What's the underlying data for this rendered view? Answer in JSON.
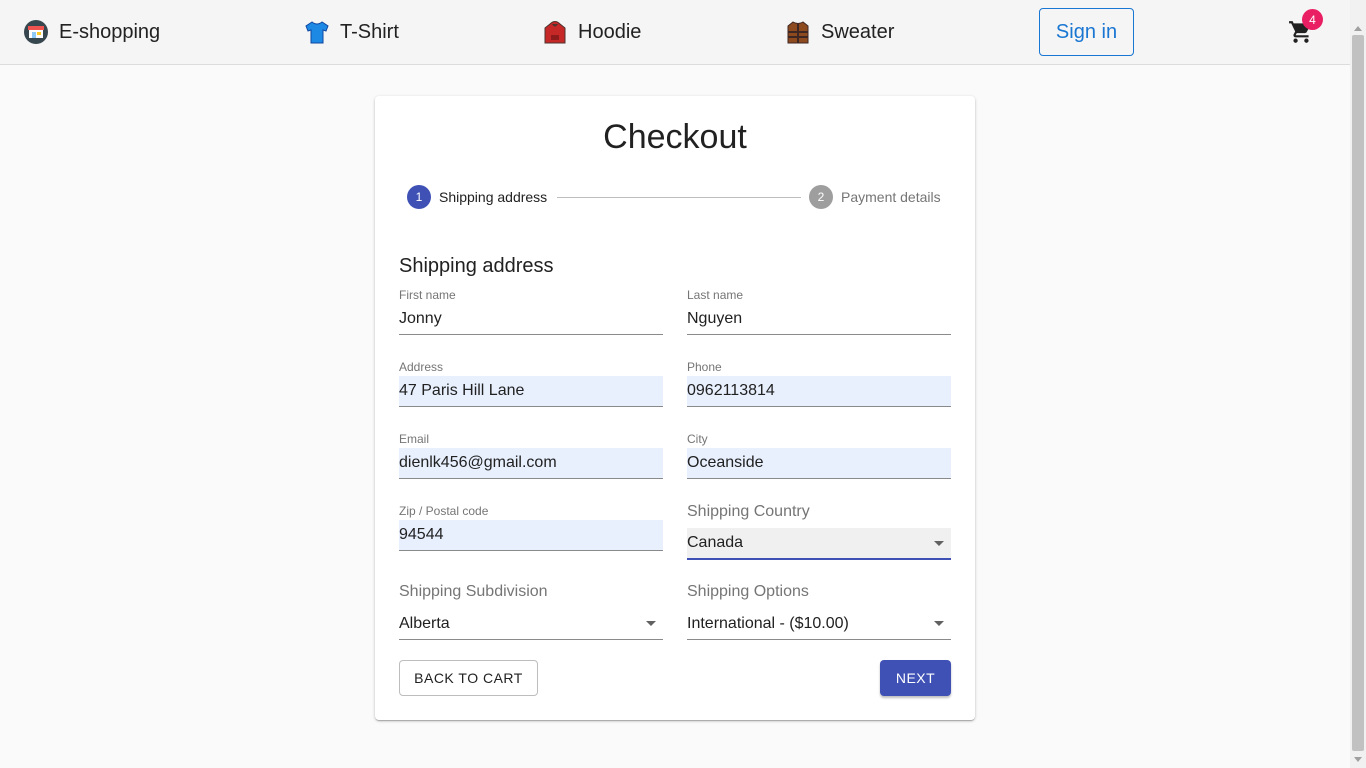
{
  "nav": {
    "brand": "E-shopping",
    "items": [
      {
        "label": "T-Shirt",
        "icon": "tshirt-icon"
      },
      {
        "label": "Hoodie",
        "icon": "hoodie-icon"
      },
      {
        "label": "Sweater",
        "icon": "sweater-icon"
      }
    ],
    "signin_label": "Sign in",
    "cart_count": "4"
  },
  "checkout": {
    "title": "Checkout",
    "steps": [
      {
        "number": "1",
        "label": "Shipping address",
        "active": true
      },
      {
        "number": "2",
        "label": "Payment details",
        "active": false
      }
    ],
    "section_title": "Shipping address",
    "fields": {
      "first_name": {
        "label": "First name",
        "value": "Jonny"
      },
      "last_name": {
        "label": "Last name",
        "value": "Nguyen"
      },
      "address": {
        "label": "Address",
        "value": "47 Paris Hill Lane"
      },
      "phone": {
        "label": "Phone",
        "value": "0962113814"
      },
      "email": {
        "label": "Email",
        "value": "dienlk456@gmail.com"
      },
      "city": {
        "label": "City",
        "value": "Oceanside"
      },
      "zip": {
        "label": "Zip / Postal code",
        "value": "94544"
      }
    },
    "selects": {
      "country": {
        "label": "Shipping Country",
        "value": "Canada"
      },
      "subdivision": {
        "label": "Shipping Subdivision",
        "value": "Alberta"
      },
      "options": {
        "label": "Shipping Options",
        "value": "International - ($10.00)"
      }
    },
    "back_label": "BACK TO CART",
    "next_label": "NEXT"
  },
  "colors": {
    "primary": "#3f51b5",
    "signin": "#1976d2",
    "badge": "#e91e63",
    "autofill": "#e8f0fe"
  }
}
